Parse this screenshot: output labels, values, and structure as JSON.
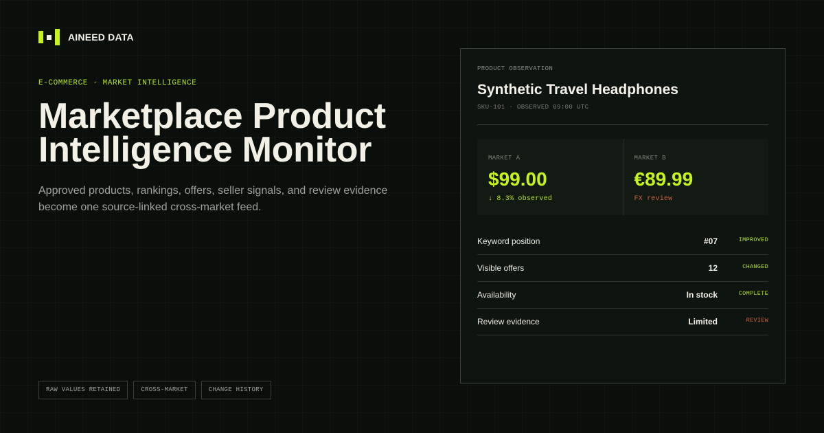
{
  "brand": {
    "name": "AINEED DATA"
  },
  "hero": {
    "eyebrow": "E-COMMERCE · MARKET INTELLIGENCE",
    "title": "Marketplace Product Intelligence Monitor",
    "subtitle": "Approved products, rankings, offers, seller signals, and review evidence become one source-linked cross-market feed."
  },
  "chips": [
    "RAW VALUES RETAINED",
    "CROSS-MARKET",
    "CHANGE HISTORY"
  ],
  "panel": {
    "eyebrow": "PRODUCT OBSERVATION",
    "product_name": "Synthetic Travel Headphones",
    "meta": "SKU-101 · OBSERVED 09:00 UTC",
    "markets": [
      {
        "label": "MARKET A",
        "price": "$99.00",
        "note": "↓ 8.3% observed",
        "note_tone": "good"
      },
      {
        "label": "MARKET B",
        "price": "€89.99",
        "note": "FX review",
        "note_tone": "warn"
      }
    ],
    "rows": [
      {
        "label": "Keyword position",
        "value": "#07",
        "status": "IMPROVED",
        "tone": "good"
      },
      {
        "label": "Visible offers",
        "value": "12",
        "status": "CHANGED",
        "tone": "good"
      },
      {
        "label": "Availability",
        "value": "In stock",
        "status": "COMPLETE",
        "tone": "good"
      },
      {
        "label": "Review evidence",
        "value": "Limited",
        "status": "REVIEW",
        "tone": "warn"
      }
    ]
  },
  "colors": {
    "background": "#0a0f0b",
    "accent": "#c6f31a",
    "warning": "#d4643e",
    "panel": "#0e1410"
  }
}
